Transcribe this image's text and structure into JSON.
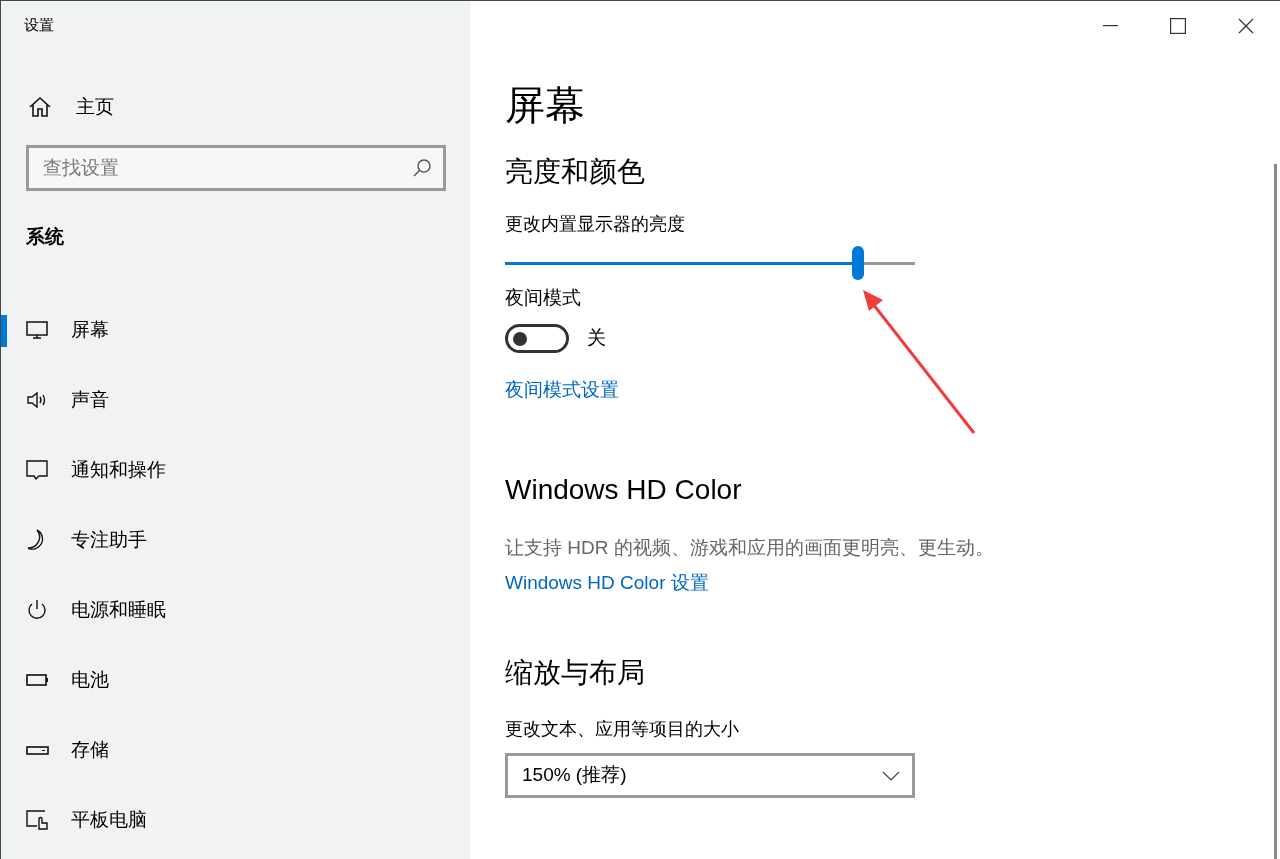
{
  "window": {
    "title": "设置"
  },
  "sidebar": {
    "home": {
      "label": "主页"
    },
    "search": {
      "placeholder": "查找设置"
    },
    "section": "系统",
    "items": [
      {
        "label": "屏幕",
        "selected": true
      },
      {
        "label": "声音",
        "selected": false
      },
      {
        "label": "通知和操作",
        "selected": false
      },
      {
        "label": "专注助手",
        "selected": false
      },
      {
        "label": "电源和睡眠",
        "selected": false
      },
      {
        "label": "电池",
        "selected": false
      },
      {
        "label": "存储",
        "selected": false
      },
      {
        "label": "平板电脑",
        "selected": false
      }
    ]
  },
  "page": {
    "title": "屏幕",
    "brightness": {
      "heading": "亮度和颜色",
      "slider_label": "更改内置显示器的亮度",
      "level": 0.86
    },
    "night_light": {
      "label": "夜间模式",
      "on": false,
      "state_text": "关",
      "link": "夜间模式设置"
    },
    "hd_color": {
      "heading": "Windows HD Color",
      "description": "让支持 HDR 的视频、游戏和应用的画面更明亮、更生动。",
      "link": "Windows HD Color 设置"
    },
    "scale": {
      "heading": "缩放与布局",
      "label": "更改文本、应用等项目的大小",
      "value": "150% (推荐)"
    }
  }
}
